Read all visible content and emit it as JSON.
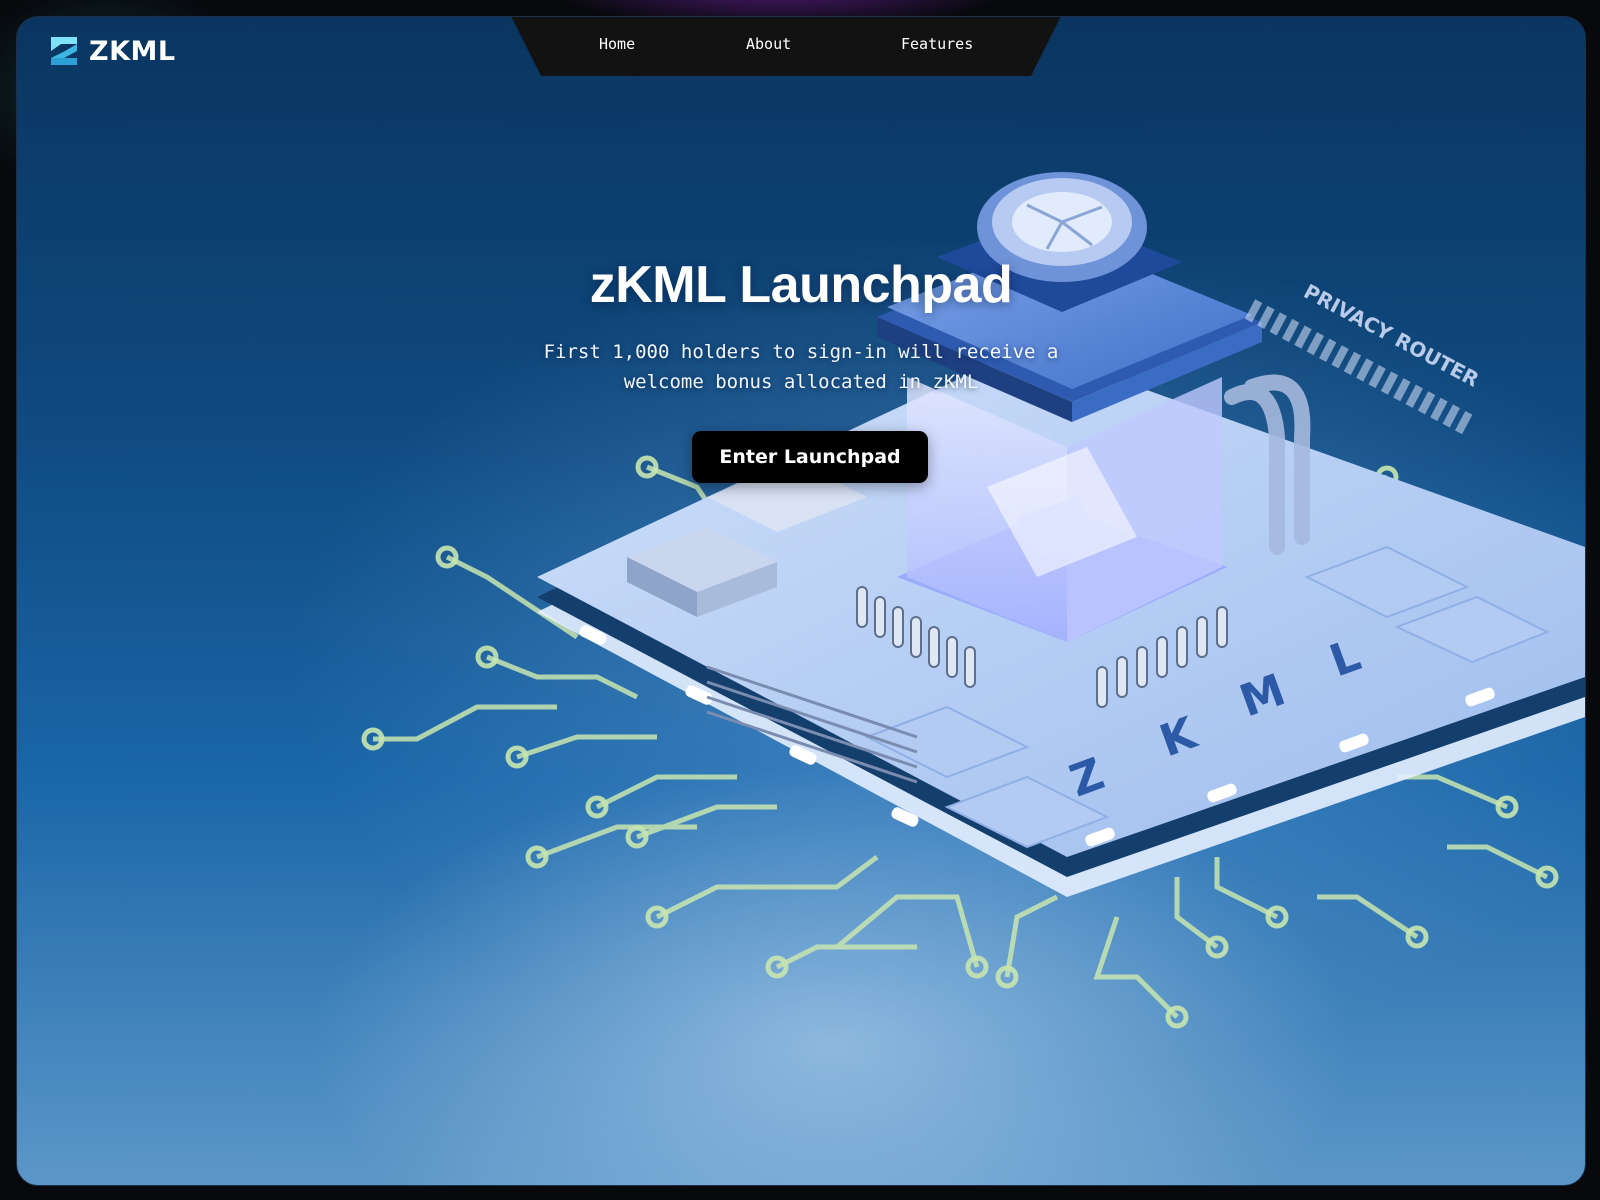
{
  "brand": {
    "name": "ZKML",
    "logo_icon": "z-logo-icon"
  },
  "nav": {
    "items": [
      {
        "label": "Home"
      },
      {
        "label": "About"
      },
      {
        "label": "Features"
      }
    ]
  },
  "hero": {
    "title": "zKML Launchpad",
    "subtitle": "First 1,000 holders to sign-in will receive a welcome bonus allocated in zKML",
    "cta_label": "Enter Launchpad"
  },
  "illustration": {
    "chip_letters": [
      "Z",
      "K",
      "M",
      "L"
    ],
    "side_label": "PRIVACY ROUTER"
  },
  "colors": {
    "background_dark": "#07090d",
    "hero_blue": "#0f4a80",
    "nav_bg": "#121212",
    "button_bg": "#000000",
    "circuit_trace": "#c8e6b0",
    "logo_cyan": "#4fd0f0"
  }
}
